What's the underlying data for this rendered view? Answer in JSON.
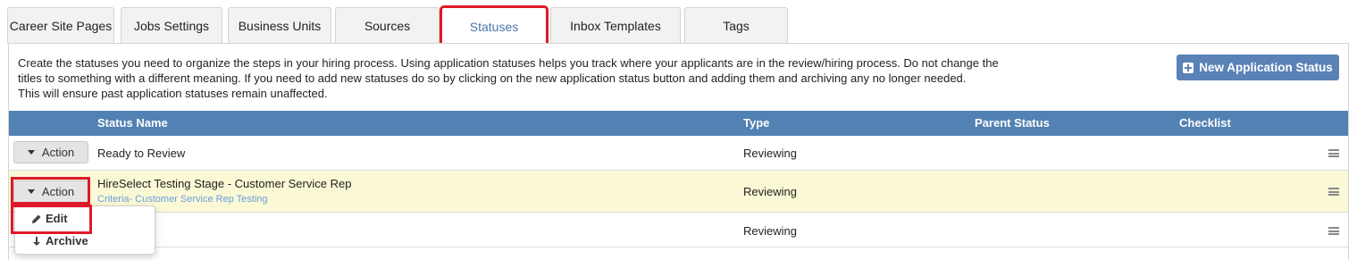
{
  "tabs": [
    {
      "label": "Career Site Pages"
    },
    {
      "label": "Jobs Settings"
    },
    {
      "label": "Business Units"
    },
    {
      "label": "Sources"
    },
    {
      "label": "Statuses"
    },
    {
      "label": "Inbox Templates"
    },
    {
      "label": "Tags"
    }
  ],
  "description": {
    "line1": "Create the statuses you need to organize the steps in your hiring process. Using application statuses helps you track where your applicants are in the review/hiring process. Do not change the",
    "line2": "titles to something with a different meaning. If you need to add new statuses do so by clicking on the new application status button and adding them and archiving any no longer needed.",
    "line3": "This will ensure past application statuses remain unaffected."
  },
  "new_button_label": "New Application Status",
  "table": {
    "headers": {
      "status_name": "Status Name",
      "type": "Type",
      "parent": "Parent Status",
      "checklist": "Checklist"
    },
    "rows": [
      {
        "action": "Action",
        "name": "Ready to Review",
        "criteria": "",
        "type": "Reviewing"
      },
      {
        "action": "Action",
        "name": "HireSelect Testing Stage - Customer Service Rep",
        "criteria": "Criteria- Customer Service Rep Testing",
        "type": "Reviewing"
      },
      {
        "action": "",
        "name": "",
        "criteria": "",
        "type": "Reviewing"
      }
    ]
  },
  "action_menu": {
    "edit": "Edit",
    "archive": "Archive"
  },
  "colors": {
    "header_blue": "#5281b3",
    "button_blue": "#5a82b6",
    "highlight_red": "#e0192b",
    "selected_row": "#fbf8d6",
    "active_tab_text": "#4d77a8"
  }
}
